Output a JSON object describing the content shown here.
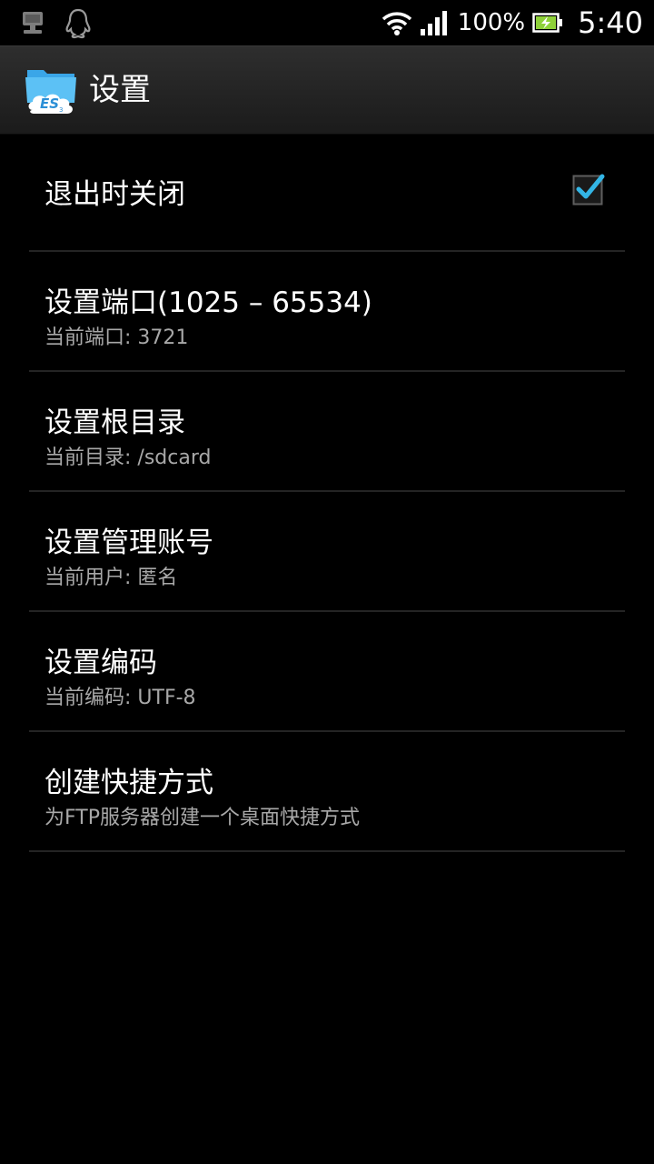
{
  "status_bar": {
    "battery_percent": "100%",
    "time": "5:40",
    "icons": [
      "server-icon",
      "qq-penguin-icon",
      "wifi-icon",
      "signal-icon",
      "battery-charging-icon"
    ]
  },
  "header": {
    "title": "设置",
    "app_icon": "es-app-icon"
  },
  "settings": {
    "items": [
      {
        "title": "退出时关闭",
        "checked": true
      },
      {
        "title": "设置端口(1025 – 65534)",
        "summary": "当前端口: 3721"
      },
      {
        "title": "设置根目录",
        "summary": "当前目录: /sdcard"
      },
      {
        "title": "设置管理账号",
        "summary": "当前用户: 匿名"
      },
      {
        "title": "设置编码",
        "summary": "当前编码: UTF-8"
      },
      {
        "title": "创建快捷方式",
        "summary": "为FTP服务器创建一个桌面快捷方式"
      }
    ]
  },
  "colors": {
    "checkbox_accent": "#33b5e5",
    "summary_text": "#a8a8a8",
    "divider": "#242424"
  }
}
